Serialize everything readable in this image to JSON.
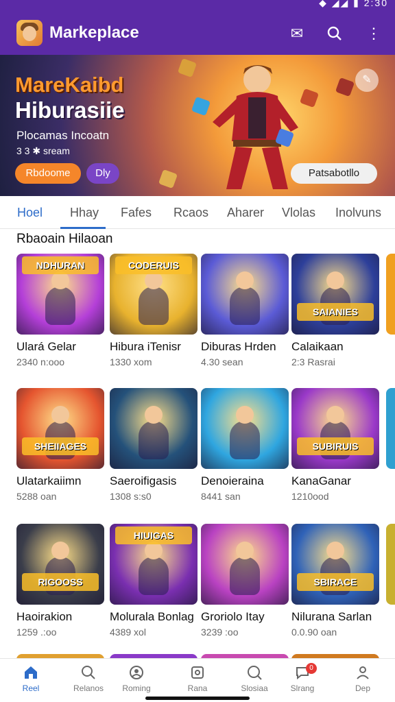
{
  "status": {
    "time": "2:30"
  },
  "header": {
    "title": "Markeplace"
  },
  "hero": {
    "title_line1": "MareKaibd",
    "title_line2": "Hiburasiie",
    "subtitle": "Plocamas Incoatn",
    "meta": "3 3 ✱ sream",
    "button_primary": "Rbdoome",
    "button_secondary": "Dly",
    "button_right": "Patsabotllo"
  },
  "tabs": [
    {
      "label": "Hoel"
    },
    {
      "label": "Hhay"
    },
    {
      "label": "Fafes"
    },
    {
      "label": "Rcaos"
    },
    {
      "label": "Aharer"
    },
    {
      "label": "Vlolas"
    },
    {
      "label": "Inolvuns"
    }
  ],
  "section": {
    "title": "Rbaoain Hilaoan"
  },
  "games": [
    {
      "name": "Ulará Gelar",
      "meta": "2340 n:ooo",
      "badge": "NDHURAN",
      "bg": "#b43fd8"
    },
    {
      "name": "Hibura iTenisr",
      "meta": "1330 xom",
      "badge": "CODERUIS",
      "bg": "#e8b22e"
    },
    {
      "name": "Diburas Hrden",
      "meta": "4.30 sean",
      "badge": "",
      "bg": "#5b5bd6"
    },
    {
      "name": "Calaikaan",
      "meta": "2:3 Rasrai",
      "badge": "SAIANIES",
      "bg": "#2d3f9a"
    },
    {
      "name": "Ulatarkaiimn",
      "meta": "5288 oan",
      "badge": "SHEIIAGES",
      "bg": "#e5552f"
    },
    {
      "name": "Saeroifigasis",
      "meta": "1308 s:s0",
      "badge": "",
      "bg": "#24517a"
    },
    {
      "name": "Denoieraina",
      "meta": "8441 san",
      "badge": "",
      "bg": "#2fa6e0"
    },
    {
      "name": "KanaGanar",
      "meta": "1210ood",
      "badge": "SUBIRUIS",
      "bg": "#9a39c9"
    },
    {
      "name": "Haoirakion",
      "meta": "1259 .:oo",
      "badge": "RIGOOSS",
      "bg": "#3a3d4a"
    },
    {
      "name": "Molurala Bonlag",
      "meta": "4389 xol",
      "badge": "HIUIGAS",
      "bg": "#7a2fb0"
    },
    {
      "name": "Groriolo Itay",
      "meta": "3239 :oo",
      "badge": "",
      "bg": "#b942c2"
    },
    {
      "name": "Nilurana Sarlan",
      "meta": "0.0.90 oan",
      "badge": "SBIRACE",
      "bg": "#2f62b8"
    }
  ],
  "bottom_nav": [
    {
      "label": "Reel",
      "icon": "home-icon"
    },
    {
      "label": "Relanos",
      "icon": "search-icon"
    },
    {
      "label": "Roming",
      "icon": "profile-icon"
    },
    {
      "label": "Rana",
      "icon": "shop-icon"
    },
    {
      "label": "Slosiaa",
      "icon": "search-icon"
    },
    {
      "label": "Slrang",
      "icon": "chat-icon"
    },
    {
      "label": "Dep",
      "icon": "user-icon"
    }
  ],
  "nav_badge": "0",
  "colors": {
    "brand": "#5b2aa6",
    "accent": "#2d6cc9",
    "orange": "#f5862a"
  }
}
